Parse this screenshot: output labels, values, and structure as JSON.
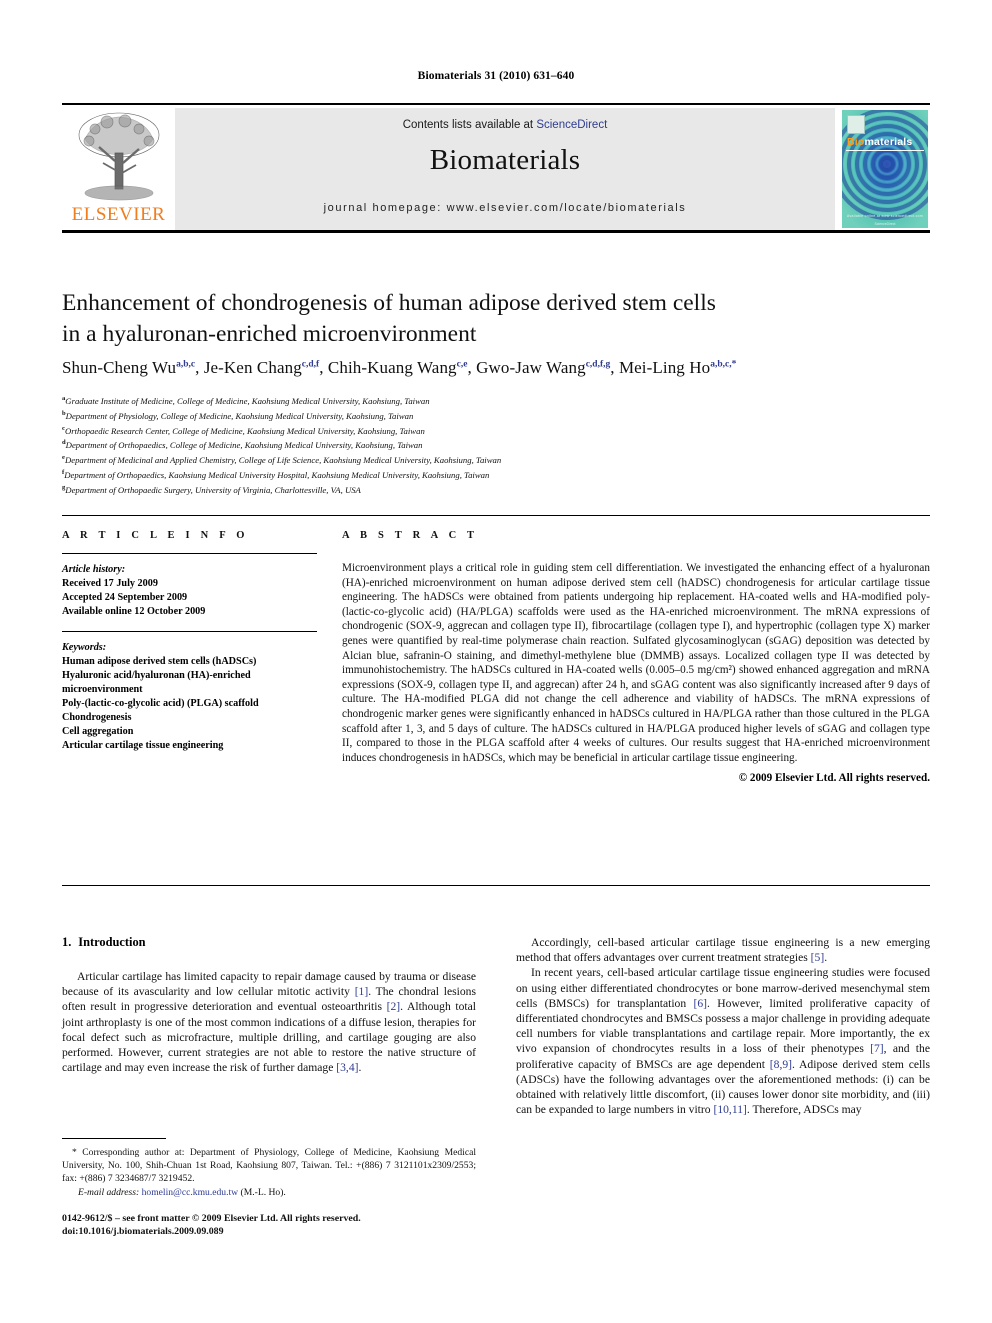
{
  "running_head": "Biomaterials 31 (2010) 631–640",
  "masthead": {
    "contents_prefix": "Contents lists available at ",
    "sciencedirect": "ScienceDirect",
    "journal_name": "Biomaterials",
    "homepage": "journal homepage: www.elsevier.com/locate/biomaterials",
    "publisher_wordmark": "ELSEVIER",
    "publisher_color": "#F07D1E",
    "link_color": "#2F3C90",
    "band_color": "#e8e8e8",
    "cover": {
      "title_part1": "Bio",
      "title_part2": "materials",
      "footer_line1": "Available online at www.sciencedirect.com",
      "footer_line2": "ScienceDirect",
      "bg_color": "#3fb8b2",
      "accent_color": "#ff9c1a"
    }
  },
  "article": {
    "title_line1": "Enhancement of chondrogenesis of human adipose derived stem cells",
    "title_line2": "in a hyaluronan-enriched microenvironment",
    "authors": [
      {
        "name": "Shun-Cheng Wu",
        "marks": "a,b,c",
        "sep": ", "
      },
      {
        "name": "Je-Ken Chang",
        "marks": "c,d,f",
        "sep": ", "
      },
      {
        "name": "Chih-Kuang Wang",
        "marks": "c,e",
        "sep": ", "
      },
      {
        "name": "Gwo-Jaw Wang",
        "marks": "c,d,f,g",
        "sep": ", "
      },
      {
        "name": "Mei-Ling Ho",
        "marks": "a,b,c,*",
        "sep": ""
      }
    ],
    "affiliations": [
      {
        "mark": "a",
        "text": "Graduate Institute of Medicine, College of Medicine, Kaohsiung Medical University, Kaohsiung, Taiwan"
      },
      {
        "mark": "b",
        "text": "Department of Physiology, College of Medicine, Kaohsiung Medical University, Kaohsiung, Taiwan"
      },
      {
        "mark": "c",
        "text": "Orthopaedic Research Center, College of Medicine, Kaohsiung Medical University, Kaohsiung, Taiwan"
      },
      {
        "mark": "d",
        "text": "Department of Orthopaedics, College of Medicine, Kaohsiung Medical University, Kaohsiung, Taiwan"
      },
      {
        "mark": "e",
        "text": "Department of Medicinal and Applied Chemistry, College of Life Science, Kaohsiung Medical University, Kaohsiung, Taiwan"
      },
      {
        "mark": "f",
        "text": "Department of Orthopaedics, Kaohsiung Medical University Hospital, Kaohsiung Medical University, Kaohsiung, Taiwan"
      },
      {
        "mark": "g",
        "text": "Department of Orthopaedic Surgery, University of Virginia, Charlottesville, VA, USA"
      }
    ]
  },
  "article_info": {
    "heading": "A R T I C L E  I N F O",
    "history_label": "Article history:",
    "history": [
      "Received 17 July 2009",
      "Accepted 24 September 2009",
      "Available online 12 October 2009"
    ],
    "keywords_label": "Keywords:",
    "keywords": [
      "Human adipose derived stem cells (hADSCs)",
      "Hyaluronic acid/hyaluronan (HA)-enriched microenvironment",
      "Poly-(lactic-co-glycolic acid) (PLGA) scaffold",
      "Chondrogenesis",
      "Cell aggregation",
      "Articular cartilage tissue engineering"
    ]
  },
  "abstract": {
    "heading": "A B S T R A C T",
    "text": "Microenvironment plays a critical role in guiding stem cell differentiation. We investigated the enhancing effect of a hyaluronan (HA)-enriched microenvironment on human adipose derived stem cell (hADSC) chondrogenesis for articular cartilage tissue engineering. The hADSCs were obtained from patients undergoing hip replacement. HA-coated wells and HA-modified poly-(lactic-co-glycolic acid) (HA/PLGA) scaffolds were used as the HA-enriched microenvironment. The mRNA expressions of chondrogenic (SOX-9, aggrecan and collagen type II), fibrocartilage (collagen type I), and hypertrophic (collagen type X) marker genes were quantified by real-time polymerase chain reaction. Sulfated glycosaminoglycan (sGAG) deposition was detected by Alcian blue, safranin-O staining, and dimethyl-methylene blue (DMMB) assays. Localized collagen type II was detected by immunohistochemistry. The hADSCs cultured in HA-coated wells (0.005–0.5 mg/cm²) showed enhanced aggregation and mRNA expressions (SOX-9, collagen type II, and aggrecan) after 24 h, and sGAG content was also significantly increased after 9 days of culture. The HA-modified PLGA did not change the cell adherence and viability of hADSCs. The mRNA expressions of chondrogenic marker genes were significantly enhanced in hADSCs cultured in HA/PLGA rather than those cultured in the PLGA scaffold after 1, 3, and 5 days of culture. The hADSCs cultured in HA/PLGA produced higher levels of sGAG and collagen type II, compared to those in the PLGA scaffold after 4 weeks of cultures. Our results suggest that HA-enriched microenvironment induces chondrogenesis in hADSCs, which may be beneficial in articular cartilage tissue engineering.",
    "copyright": "© 2009 Elsevier Ltd. All rights reserved."
  },
  "intro": {
    "number": "1.",
    "heading": "Introduction",
    "left_paragraph_1_a": "Articular cartilage has limited capacity to repair damage caused by trauma or disease because of its avascularity and low cellular mitotic activity ",
    "ref1": "[1]",
    "left_paragraph_1_b": ". The chondral lesions often result in progressive deterioration and eventual osteoarthritis ",
    "ref2": "[2]",
    "left_paragraph_1_c": ". Although total joint arthroplasty is one of the most common indications of a diffuse lesion, therapies for focal defect such as microfracture, multiple drilling, and cartilage gouging are also performed. However, current strategies are not able to restore the native structure of cartilage and may even increase the risk of further damage ",
    "ref3": "[3,4]",
    "left_paragraph_1_d": ".",
    "right_paragraph_1_a": "Accordingly, cell-based articular cartilage tissue engineering is a new emerging method that offers advantages over current treatment strategies ",
    "ref5": "[5]",
    "right_paragraph_1_b": ".",
    "right_paragraph_2_a": "In recent years, cell-based articular cartilage tissue engineering studies were focused on using either differentiated chondrocytes or bone marrow-derived mesenchymal stem cells (BMSCs) for transplantation ",
    "ref6": "[6]",
    "right_paragraph_2_b": ". However, limited proliferative capacity of differentiated chondrocytes and BMSCs possess a major challenge in providing adequate cell numbers for viable transplantations and cartilage repair. More importantly, the ex vivo expansion of chondrocytes results in a loss of their phenotypes ",
    "ref7": "[7]",
    "right_paragraph_2_c": ", and the proliferative capacity of BMSCs are age dependent ",
    "ref89": "[8,9]",
    "right_paragraph_2_d": ". Adipose derived stem cells (ADSCs) have the following advantages over the aforementioned methods: (i) can be obtained with relatively little discomfort, (ii) causes lower donor site morbidity, and (iii) can be expanded to large numbers in vitro ",
    "ref1011": "[10,11]",
    "right_paragraph_2_e": ". Therefore, ADSCs may"
  },
  "footnotes": {
    "corresponding": "* Corresponding author at: Department of Physiology, College of Medicine, Kaohsiung Medical University, No. 100, Shih-Chuan 1st Road, Kaohsiung 807, Taiwan. Tel.: +(886) 7 3121101x2309/2553; fax: +(886) 7 3234687/7 3219452.",
    "email_label": "E-mail address:",
    "email": "homelin@cc.kmu.edu.tw",
    "email_owner": "(M.-L. Ho)."
  },
  "imprint": {
    "line1": "0142-9612/$ – see front matter © 2009 Elsevier Ltd. All rights reserved.",
    "line2": "doi:10.1016/j.biomaterials.2009.09.089"
  }
}
